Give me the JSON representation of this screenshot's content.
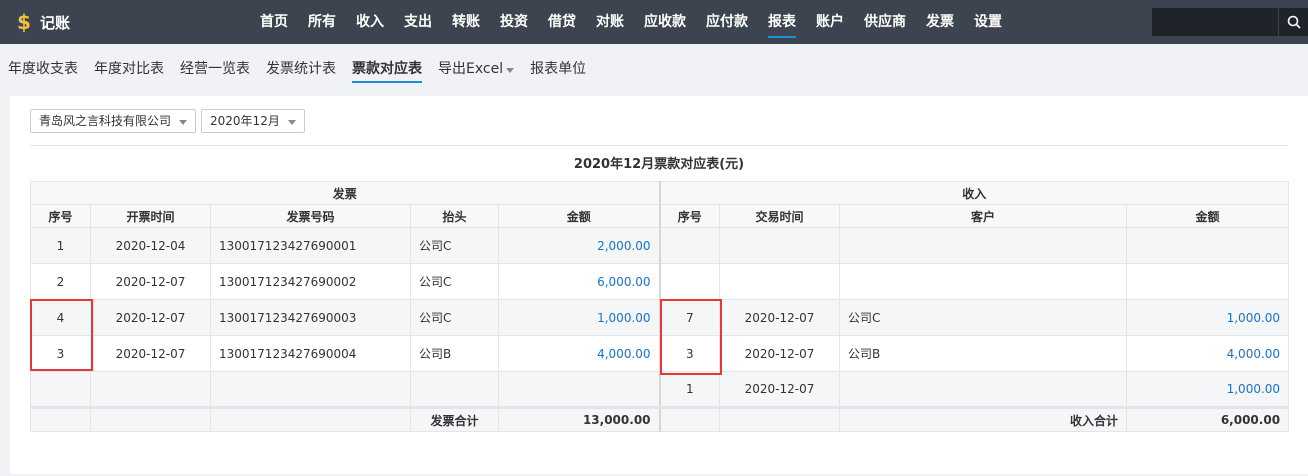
{
  "app": {
    "logo_symbol": "$",
    "name": "记账"
  },
  "nav": {
    "items": [
      {
        "label": "首页"
      },
      {
        "label": "所有"
      },
      {
        "label": "收入"
      },
      {
        "label": "支出"
      },
      {
        "label": "转账"
      },
      {
        "label": "投资"
      },
      {
        "label": "借贷"
      },
      {
        "label": "对账"
      },
      {
        "label": "应收款"
      },
      {
        "label": "应付款"
      },
      {
        "label": "报表"
      },
      {
        "label": "账户"
      },
      {
        "label": "供应商"
      },
      {
        "label": "发票"
      },
      {
        "label": "设置"
      }
    ],
    "active": "报表",
    "search_placeholder": ""
  },
  "subnav": {
    "items": [
      {
        "label": "年度收支表"
      },
      {
        "label": "年度对比表"
      },
      {
        "label": "经营一览表"
      },
      {
        "label": "发票统计表"
      },
      {
        "label": "票款对应表"
      },
      {
        "label": "导出Excel"
      },
      {
        "label": "报表单位"
      }
    ],
    "active": "票款对应表"
  },
  "filters": {
    "company": "青岛风之言科技有限公司",
    "period": "2020年12月"
  },
  "report": {
    "title": "2020年12月票款对应表(元)",
    "invoice_group": "发票",
    "income_group": "收入",
    "invoice_headers": [
      "序号",
      "开票时间",
      "发票号码",
      "抬头",
      "金额"
    ],
    "income_headers": [
      "序号",
      "交易时间",
      "客户",
      "金额"
    ],
    "rows": [
      {
        "invoice": {
          "no": "1",
          "date": "2020-12-04",
          "number": "130017123427690001",
          "title": "公司C",
          "amount": "2,000.00"
        },
        "income": {
          "no": "",
          "date": "",
          "customer": "",
          "amount": ""
        }
      },
      {
        "invoice": {
          "no": "2",
          "date": "2020-12-07",
          "number": "130017123427690002",
          "title": "公司C",
          "amount": "6,000.00"
        },
        "income": {
          "no": "",
          "date": "",
          "customer": "",
          "amount": ""
        }
      },
      {
        "invoice": {
          "no": "4",
          "date": "2020-12-07",
          "number": "130017123427690003",
          "title": "公司C",
          "amount": "1,000.00"
        },
        "income": {
          "no": "7",
          "date": "2020-12-07",
          "customer": "公司C",
          "amount": "1,000.00"
        }
      },
      {
        "invoice": {
          "no": "3",
          "date": "2020-12-07",
          "number": "130017123427690004",
          "title": "公司B",
          "amount": "4,000.00"
        },
        "income": {
          "no": "3",
          "date": "2020-12-07",
          "customer": "公司B",
          "amount": "4,000.00"
        }
      },
      {
        "invoice": {
          "no": "",
          "date": "",
          "number": "",
          "title": "",
          "amount": ""
        },
        "income": {
          "no": "1",
          "date": "2020-12-07",
          "customer": "",
          "amount": "1,000.00"
        }
      }
    ],
    "invoice_total_label": "发票合计",
    "invoice_total": "13,000.00",
    "income_total_label": "收入合计",
    "income_total": "6,000.00"
  },
  "colors": {
    "topbar": "#3c4450",
    "accent": "#1a8fd8",
    "amount": "#1a73c8",
    "highlight": "#e53935"
  }
}
